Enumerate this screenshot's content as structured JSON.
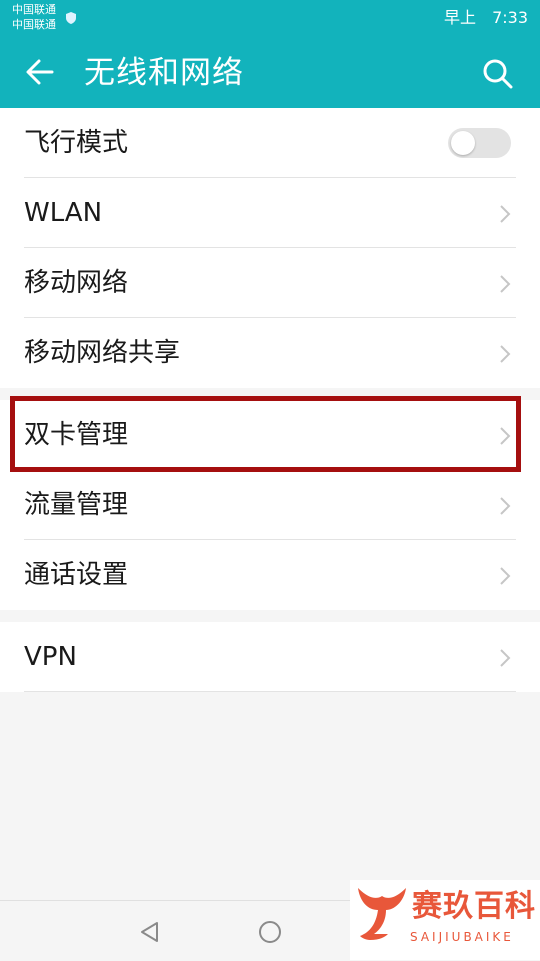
{
  "status_bar": {
    "carrier_1": "中国联通",
    "carrier_2": "中国联通",
    "time_prefix": "早上",
    "time": "7:33"
  },
  "header": {
    "title": "无线和网络"
  },
  "settings": {
    "airplane": {
      "label": "飞行模式",
      "toggle_on": false
    },
    "wlan": "WLAN",
    "mobile_network": "移动网络",
    "tethering": "移动网络共享",
    "dual_sim": "双卡管理",
    "data_usage": "流量管理",
    "call_settings": "通话设置",
    "vpn": "VPN"
  },
  "watermark": {
    "name": "赛玖百科",
    "subtitle": "SAIJIUBAIKE"
  },
  "colors": {
    "header": "#12b3bc",
    "highlight": "#a50f0f",
    "logo": "#e8573a"
  }
}
